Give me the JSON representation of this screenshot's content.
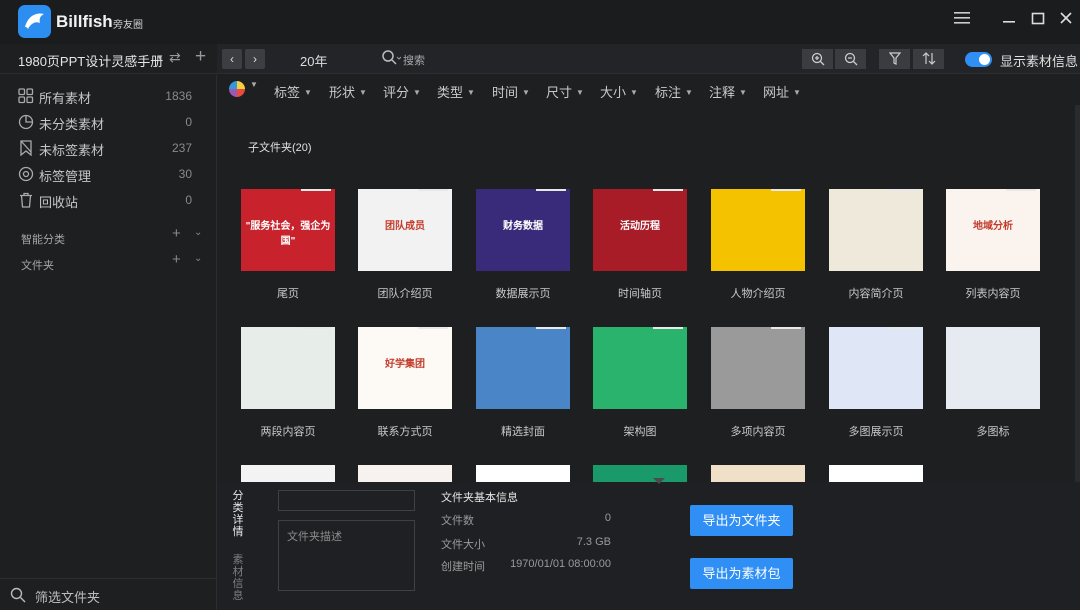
{
  "app": {
    "name": "Billfish",
    "subtitle": "旁友圈"
  },
  "window": {
    "menu_icon": "hamburger-icon",
    "minimize_icon": "minimize-icon",
    "maximize_icon": "maximize-icon",
    "close_icon": "close-icon"
  },
  "library": {
    "name": "1980页PPT设计灵感手册",
    "switch_icon": "swap-icon",
    "add_icon": "plus-icon"
  },
  "toolbar": {
    "folder_title": "20年",
    "search_label": "搜索",
    "show_info_label": "显示素材信息",
    "show_info_on": true,
    "accent": "#2f8ff5"
  },
  "sidebar": {
    "items": [
      {
        "label": "所有素材",
        "count": "1836",
        "icon": "grid-icon"
      },
      {
        "label": "未分类素材",
        "count": "0",
        "icon": "pie-icon"
      },
      {
        "label": "未标签素材",
        "count": "237",
        "icon": "tag-off-icon"
      },
      {
        "label": "标签管理",
        "count": "30",
        "icon": "tag-settings-icon"
      },
      {
        "label": "回收站",
        "count": "0",
        "icon": "trash-icon"
      }
    ],
    "smart_folders_label": "智能分类",
    "folders_label": "文件夹",
    "footer_filter_label": "筛选文件夹"
  },
  "filters": [
    "标签",
    "形状",
    "评分",
    "类型",
    "时间",
    "尺寸",
    "大小",
    "标注",
    "注释",
    "网址"
  ],
  "main": {
    "subfolder_title": "子文件夹(20)",
    "cards": [
      {
        "label": "尾页",
        "color": "#c8232c",
        "text": "\"服务社会，强企为国\""
      },
      {
        "label": "团队介绍页",
        "color": "#f2f2f2",
        "text": "团队成员"
      },
      {
        "label": "数据展示页",
        "color": "#3a2a7a",
        "text": "财务数据"
      },
      {
        "label": "时间轴页",
        "color": "#a81c28",
        "text": "活动历程"
      },
      {
        "label": "人物介绍页",
        "color": "#f5c200",
        "text": ""
      },
      {
        "label": "内容简介页",
        "color": "#efe9dc",
        "text": ""
      },
      {
        "label": "列表内容页",
        "color": "#fbf3ee",
        "text": "地域分析"
      },
      {
        "label": "两段内容页",
        "color": "#e7eee9",
        "text": ""
      },
      {
        "label": "联系方式页",
        "color": "#fdfaf6",
        "text": "好学集团"
      },
      {
        "label": "精选封面",
        "color": "#4a86c7",
        "text": ""
      },
      {
        "label": "架构图",
        "color": "#2ab36c",
        "text": ""
      },
      {
        "label": "多项内容页",
        "color": "#9a9a9a",
        "text": ""
      },
      {
        "label": "多图展示页",
        "color": "#dfe6f5",
        "text": ""
      },
      {
        "label": "多图标",
        "color": "#e6ebf2",
        "text": ""
      }
    ],
    "partial_card_colors": [
      "#f3f3f3",
      "#f7f2ee",
      "#ffffff",
      "#1a9a6a",
      "#f0e0c8",
      "#ffffff"
    ]
  },
  "bottom": {
    "tab_details": "分类详情",
    "tab_material": "素材信息",
    "name_value": "",
    "desc_placeholder": "文件夹描述",
    "info_title": "文件夹基本信息",
    "info": [
      {
        "key": "文件数",
        "value": "0"
      },
      {
        "key": "文件大小",
        "value": "7.3 GB"
      },
      {
        "key": "创建时间",
        "value": "1970/01/01 08:00:00"
      }
    ],
    "export_folder": "导出为文件夹",
    "export_pack": "导出为素材包"
  }
}
